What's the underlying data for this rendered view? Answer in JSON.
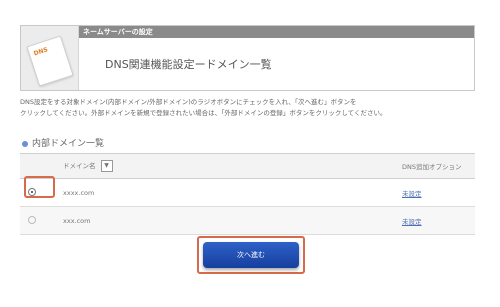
{
  "header": {
    "band_label": "ネームサーバーの設定",
    "icon_label": "DNS",
    "title": "DNS関連機能設定ードメイン一覧"
  },
  "description": {
    "line1": "DNS設定をする対象ドメイン(内部ドメイン/外部ドメイン)のラジオボタンにチェックを入れ、「次へ進む」ボタンを",
    "line2": "クリックしてください。外部ドメインを新規で登録されたい場合は、「外部ドメインの登録」ボタンをクリックしてください。"
  },
  "section": {
    "title": "内部ドメイン一覧"
  },
  "table": {
    "headers": {
      "domain": "ドメイン名",
      "option": "DNS追加オプション"
    },
    "rows": [
      {
        "domain": "xxxx.com",
        "option": "未設定",
        "selected": true
      },
      {
        "domain": "xxx.com",
        "option": "未設定",
        "selected": false
      }
    ]
  },
  "actions": {
    "next_label": "次へ進む"
  },
  "colors": {
    "accent_red": "#d66a4a",
    "primary_blue": "#2f61c8"
  }
}
